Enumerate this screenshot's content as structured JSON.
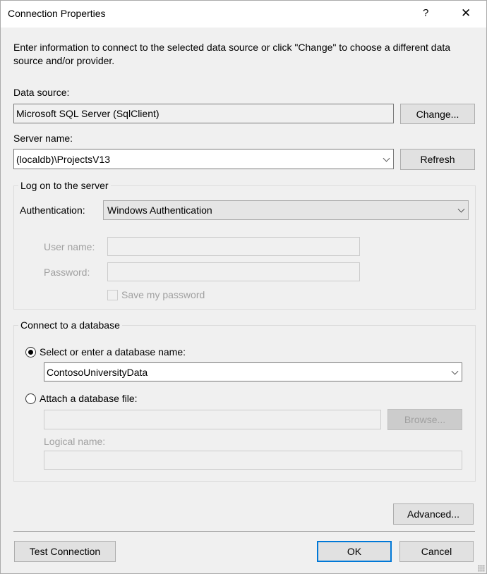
{
  "window": {
    "title": "Connection Properties",
    "help": "?",
    "close": "✕"
  },
  "intro": "Enter information to connect to the selected data source or click \"Change\" to choose a different data source and/or provider.",
  "data_source": {
    "label": "Data source:",
    "value": "Microsoft SQL Server (SqlClient)",
    "change_button": "Change..."
  },
  "server": {
    "label": "Server name:",
    "value": "(localdb)\\ProjectsV13",
    "refresh_button": "Refresh"
  },
  "logon": {
    "legend": "Log on to the server",
    "auth_label": "Authentication:",
    "auth_value": "Windows Authentication",
    "user_label": "User name:",
    "user_value": "",
    "password_label": "Password:",
    "password_value": "",
    "save_password": "Save my password",
    "save_password_checked": false
  },
  "database": {
    "legend": "Connect to a database",
    "select_option": "Select or enter a database name:",
    "select_checked": true,
    "db_name": "ContosoUniversityData",
    "attach_option": "Attach a database file:",
    "attach_checked": false,
    "file_value": "",
    "browse_button": "Browse...",
    "logical_label": "Logical name:",
    "logical_value": ""
  },
  "buttons": {
    "advanced": "Advanced...",
    "test": "Test Connection",
    "ok": "OK",
    "cancel": "Cancel"
  },
  "colors": {
    "accent": "#0078d7",
    "background": "#f0f0f0"
  }
}
